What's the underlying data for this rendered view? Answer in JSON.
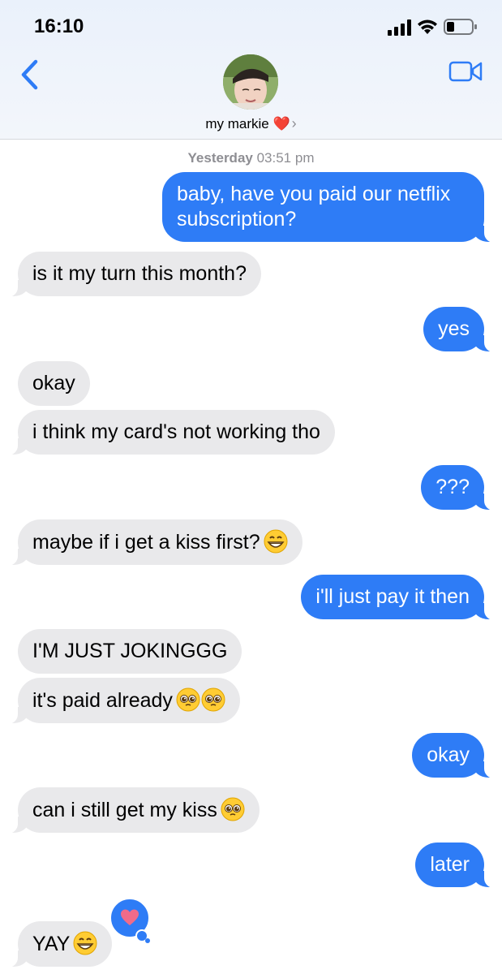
{
  "status_bar": {
    "time": "16:10"
  },
  "header": {
    "contact_name": "my markie",
    "contact_emoji": "❤️",
    "back_icon": "chevron-left-icon",
    "video_icon": "video-camera-icon"
  },
  "conversation": {
    "timestamp_day": "Yesterday",
    "timestamp_time": "03:51 pm",
    "messages": [
      {
        "from": "me",
        "text": "baby, have you paid our netflix",
        "text2": "subscription?"
      },
      {
        "from": "them",
        "text": "is it my turn this month?"
      },
      {
        "from": "me",
        "text": "yes"
      },
      {
        "from": "them",
        "text": "okay"
      },
      {
        "from": "them",
        "text": "i think my card's not working tho"
      },
      {
        "from": "me",
        "text": "???"
      },
      {
        "from": "them",
        "text": "maybe if i get a kiss first?",
        "emoji": [
          "grinning-face"
        ]
      },
      {
        "from": "me",
        "text": "i'll just pay it then"
      },
      {
        "from": "them",
        "text": "I'M JUST JOKINGGG"
      },
      {
        "from": "them",
        "text": "it's paid already",
        "emoji": [
          "pleading-face",
          "pleading-face"
        ]
      },
      {
        "from": "me",
        "text": "okay"
      },
      {
        "from": "them",
        "text": "can i still get my kiss",
        "emoji": [
          "pleading-face"
        ]
      },
      {
        "from": "me",
        "text": "later"
      },
      {
        "from": "them",
        "text": "YAY",
        "emoji": [
          "grinning-face"
        ],
        "tapback": "heart-icon"
      }
    ]
  },
  "colors": {
    "outgoing": "#2e7cf6",
    "incoming": "#e9e9eb",
    "heart": "#e0312f"
  }
}
